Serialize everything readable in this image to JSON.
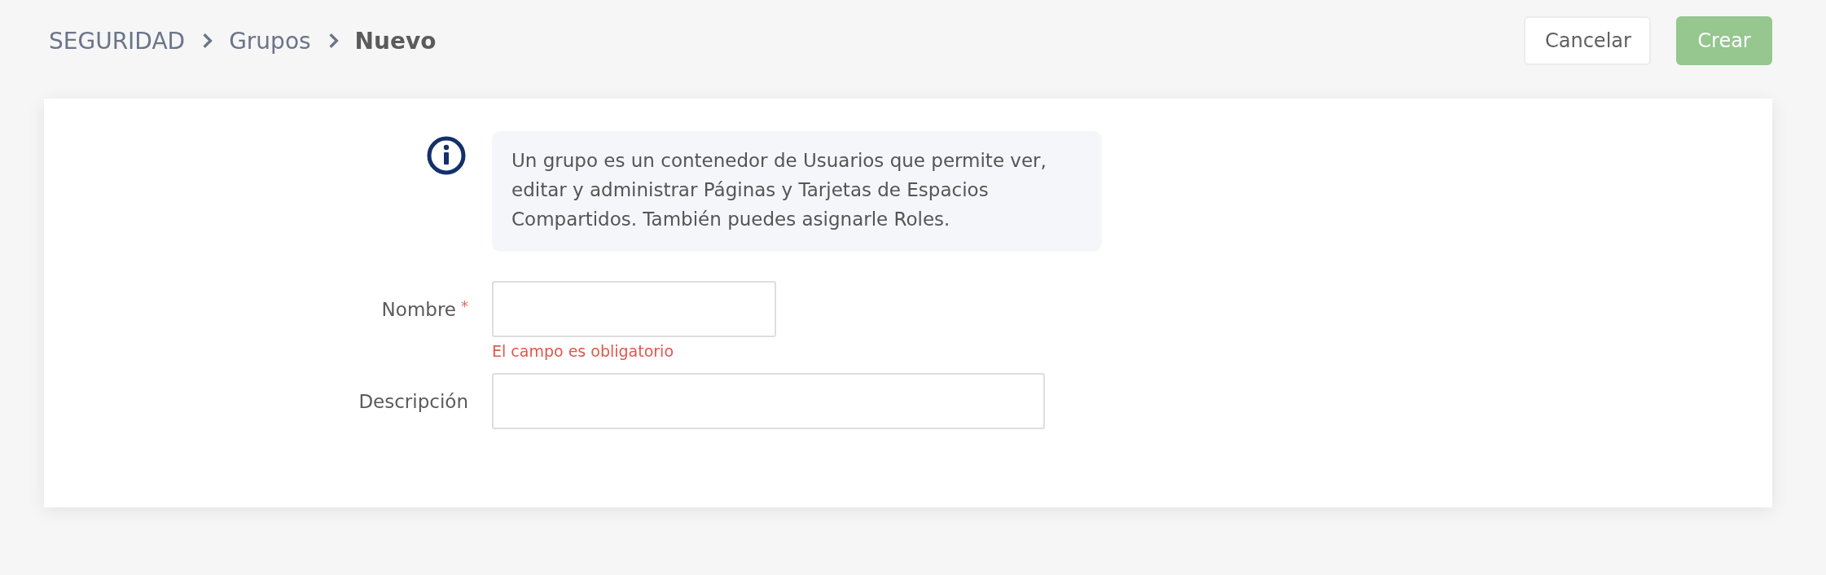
{
  "breadcrumb": [
    {
      "label": "SEGURIDAD",
      "current": false
    },
    {
      "label": "Grupos",
      "current": false
    },
    {
      "label": "Nuevo",
      "current": true
    }
  ],
  "buttons": [
    {
      "label": "Cancelar",
      "kind": "secondary"
    },
    {
      "label": "Crear",
      "kind": "primary"
    }
  ],
  "info": {
    "text": "Un grupo es un contenedor de Usuarios que permite ver, editar y administrar Páginas y Tarjetas de Espacios Compartidos. También puedes asignarle Roles."
  },
  "fields": [
    {
      "label": "Nombre",
      "required_mark": "*",
      "error": "El campo es obligatorio"
    },
    {
      "label": "Descripción"
    }
  ]
}
